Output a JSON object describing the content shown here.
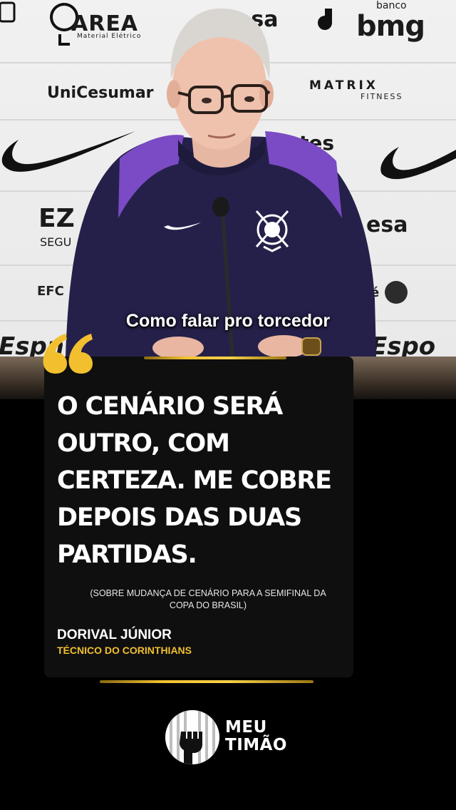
{
  "background": {
    "sponsors": [
      "AREA",
      "Material Elétrico",
      "esa",
      "banco",
      "bmg",
      "UniCesumar",
      "MATRIX",
      "FITNESS",
      "EZ",
      "SEGU",
      "esa",
      "Espn",
      "Espo",
      "tes"
    ]
  },
  "caption": "Como falar pro torcedor",
  "quote": {
    "text": "O CENÁRIO SERÁ OUTRO, COM CERTEZA. ME COBRE DEPOIS DAS DUAS PARTIDAS.",
    "context": "(SOBRE MUDANÇA DE CENÁRIO PARA A SEMIFINAL DA COPA DO BRASIL)",
    "speaker": "DORIVAL JÚNIOR",
    "role": "TÉCNICO DO CORINTHIANS",
    "quote_icon": "quote-marks-icon"
  },
  "brand": {
    "line1": "MEU",
    "line2": "TIMÃO",
    "icon": "raised-fist-icon"
  },
  "colors": {
    "accent_gold": "#f2c02f",
    "card_bg": "#0f0f0f",
    "jersey": "#25204a",
    "jersey_accent": "#7a4bc4"
  }
}
